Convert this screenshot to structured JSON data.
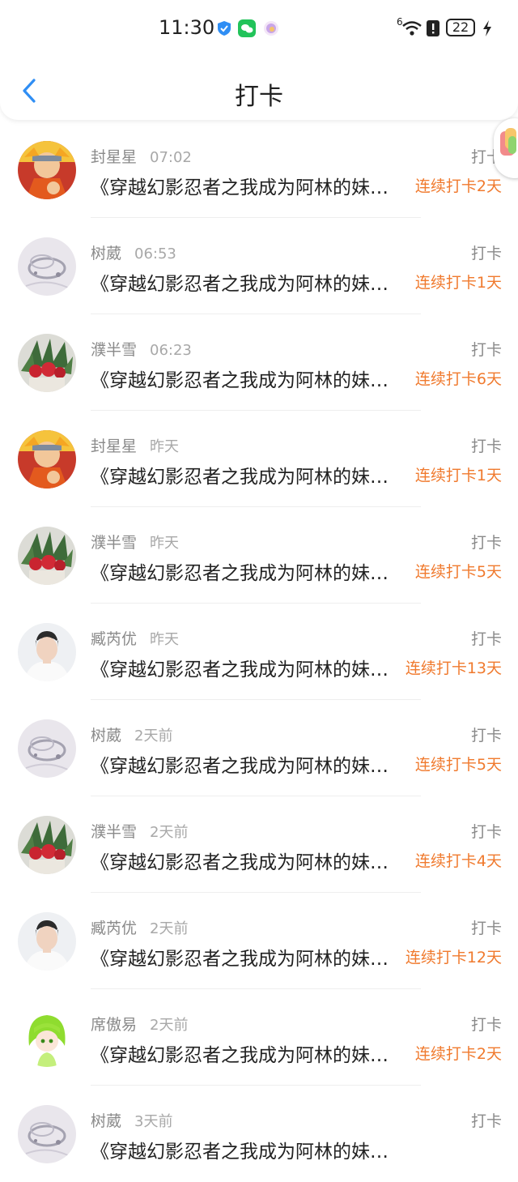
{
  "status_bar": {
    "time": "11:30",
    "signal_label": "6",
    "battery": "22",
    "icons": [
      "shield-icon",
      "wechat-icon",
      "circle-app-icon",
      "wifi-icon",
      "alert-icon",
      "battery-icon",
      "charging-icon"
    ]
  },
  "nav": {
    "title": "打卡",
    "back_icon": "chevron-left-icon"
  },
  "colors": {
    "accent": "#2f8ef4",
    "streak": "#f07a2e",
    "meta": "#8a8a8a"
  },
  "items": [
    {
      "name": "封星星",
      "time": "07:02",
      "tag": "打卡",
      "title": "《穿越幻影忍者之我成为阿林的妹妹》",
      "streak": "连续打卡2天",
      "avatar": "naruto-avatar"
    },
    {
      "name": "树葳",
      "time": "06:53",
      "tag": "打卡",
      "title": "《穿越幻影忍者之我成为阿林的妹妹》",
      "streak": "连续打卡1天",
      "avatar": "bracelet-avatar"
    },
    {
      "name": "濮半雪",
      "time": "06:23",
      "tag": "打卡",
      "title": "《穿越幻影忍者之我成为阿林的妹妹》",
      "streak": "连续打卡6天",
      "avatar": "roses-avatar"
    },
    {
      "name": "封星星",
      "time": "昨天",
      "tag": "打卡",
      "title": "《穿越幻影忍者之我成为阿林的妹妹》",
      "streak": "连续打卡1天",
      "avatar": "naruto-avatar"
    },
    {
      "name": "濮半雪",
      "time": "昨天",
      "tag": "打卡",
      "title": "《穿越幻影忍者之我成为阿林的妹妹》",
      "streak": "连续打卡5天",
      "avatar": "roses-avatar"
    },
    {
      "name": "臧芮优",
      "time": "昨天",
      "tag": "打卡",
      "title": "《穿越幻影忍者之我成为阿林的妹妹》",
      "streak": "连续打卡13天",
      "avatar": "man-avatar"
    },
    {
      "name": "树葳",
      "time": "2天前",
      "tag": "打卡",
      "title": "《穿越幻影忍者之我成为阿林的妹妹》",
      "streak": "连续打卡5天",
      "avatar": "bracelet-avatar"
    },
    {
      "name": "濮半雪",
      "time": "2天前",
      "tag": "打卡",
      "title": "《穿越幻影忍者之我成为阿林的妹妹》",
      "streak": "连续打卡4天",
      "avatar": "roses-avatar"
    },
    {
      "name": "臧芮优",
      "time": "2天前",
      "tag": "打卡",
      "title": "《穿越幻影忍者之我成为阿林的妹妹》",
      "streak": "连续打卡12天",
      "avatar": "man-avatar"
    },
    {
      "name": "席傲易",
      "time": "2天前",
      "tag": "打卡",
      "title": "《穿越幻影忍者之我成为阿林的妹妹》",
      "streak": "连续打卡2天",
      "avatar": "anime-green-avatar"
    },
    {
      "name": "树葳",
      "time": "3天前",
      "tag": "打卡",
      "title": "《穿越幻影忍者之我成为阿林的妹妹》",
      "streak": "",
      "avatar": "bracelet-avatar"
    }
  ]
}
